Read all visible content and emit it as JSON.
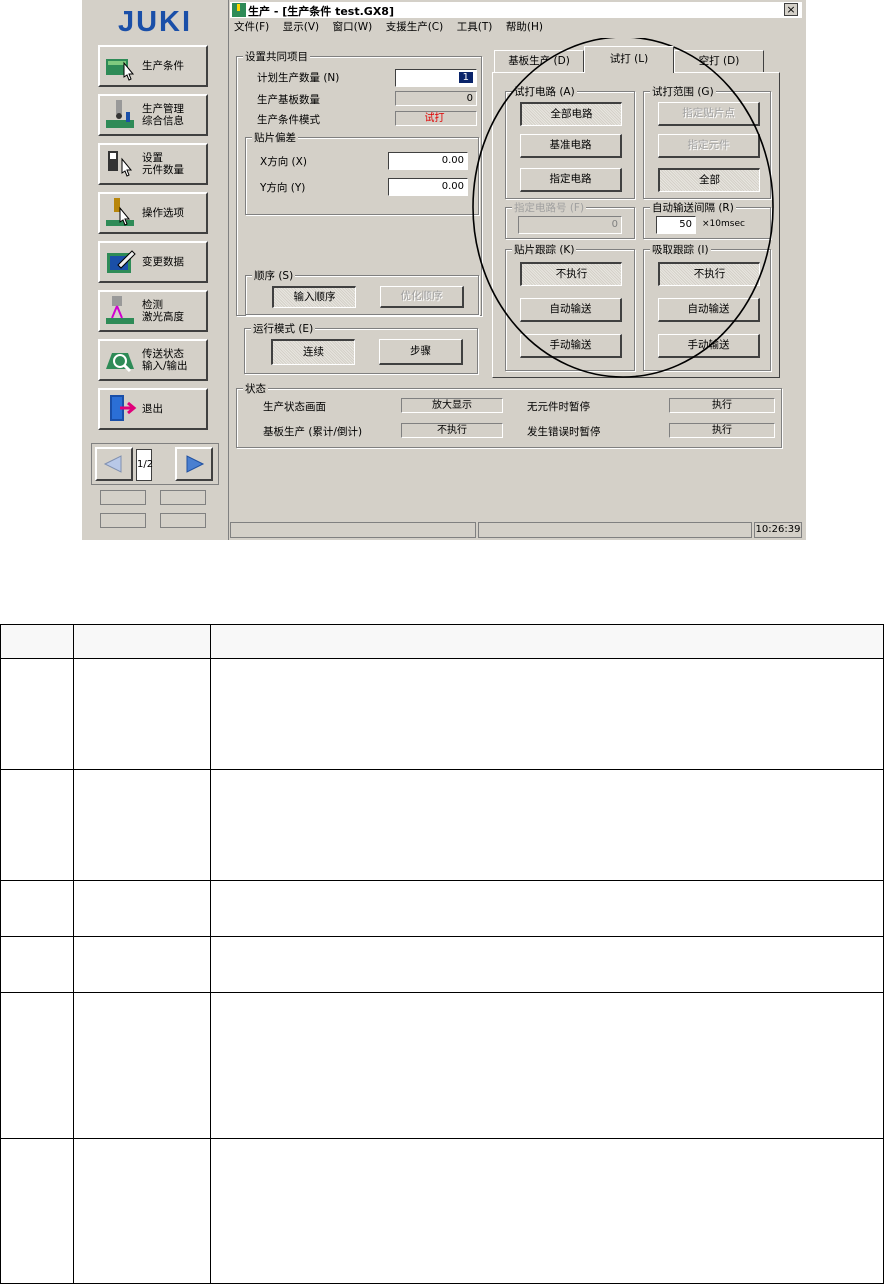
{
  "sidebar": {
    "logo": "JUKI",
    "buttons": [
      {
        "label": "生产条件",
        "icon": "production-condition-icon"
      },
      {
        "label": "生产管理\n综合信息",
        "icon": "production-management-icon"
      },
      {
        "label": "设置\n元件数量",
        "icon": "component-count-icon"
      },
      {
        "label": "操作选项",
        "icon": "operation-option-icon"
      },
      {
        "label": "变更数据",
        "icon": "change-data-icon"
      },
      {
        "label": "检测\n激光高度",
        "icon": "laser-height-icon"
      },
      {
        "label": "传送状态\n输入/输出",
        "icon": "conveyor-io-icon"
      },
      {
        "label": "退出",
        "icon": "exit-icon"
      }
    ],
    "page_indicator": "1/2"
  },
  "window": {
    "title": "生产 - [生产条件 test.GX8]",
    "close_glyph": "×",
    "menus": [
      "文件(F)",
      "显示(V)",
      "窗口(W)",
      "支援生产(C)",
      "工具(T)",
      "帮助(H)"
    ]
  },
  "common": {
    "group_label": "设置共同项目",
    "planned_qty_label": "计划生产数量 (N)",
    "planned_qty_value": "1",
    "board_count_label": "生产基板数量",
    "board_count_value": "0",
    "mode_label": "生产条件模式",
    "mode_value": "试打",
    "offset_label": "贴片偏差",
    "x_label": "X方向 (X)",
    "x_value": "0.00",
    "y_label": "Y方向 (Y)",
    "y_value": "0.00",
    "order_label": "顺序 (S)",
    "order_input": "输入顺序",
    "order_optimize": "优化顺序",
    "run_mode_label": "运行模式 (E)",
    "run_continuous": "连续",
    "run_step": "步骤"
  },
  "tabs": [
    "基板生产 (D)",
    "试打 (L)",
    "空打 (D)"
  ],
  "trial": {
    "circuit_label": "试打电路 (A)",
    "all_circuits": "全部电路",
    "ref_circuit": "基准电路",
    "spec_circuit": "指定电路",
    "range_label": "试打范围 (G)",
    "spec_point": "指定贴片点",
    "spec_component": "指定元件",
    "all": "全部",
    "circuit_no_label": "指定电路号 (F)",
    "circuit_no_value": "0",
    "auto_interval_label": "自动输送间隔 (R)",
    "auto_interval_value": "50",
    "auto_interval_unit": "×10msec",
    "place_track_label": "贴片跟踪 (K)",
    "pick_track_label": "吸取跟踪 (I)",
    "not_exec": "不执行",
    "auto_feed": "自动输送",
    "manual_feed": "手动输送"
  },
  "status": {
    "group_label": "状态",
    "screen_label": "生产状态画面",
    "screen_value": "放大显示",
    "no_comp_label": "无元件时暂停",
    "no_comp_value": "执行",
    "board_label": "基板生产 (累计/倒计)",
    "board_value": "不执行",
    "error_label": "发生错误时暂停",
    "error_value": "执行"
  },
  "statusbar": {
    "time": "10:26:39"
  }
}
